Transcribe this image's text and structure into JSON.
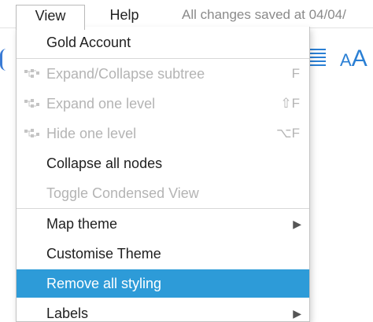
{
  "menubar": {
    "view_label": "View",
    "help_label": "Help",
    "save_status": "All changes saved at 04/04/"
  },
  "toolbar": {
    "font_icon_text_small": "A",
    "font_icon_text_large": "A"
  },
  "dropdown": {
    "account": "Gold Account",
    "expand_collapse_subtree": {
      "label": "Expand/Collapse subtree",
      "shortcut": "F",
      "icon": "tree-icon"
    },
    "expand_one_level": {
      "label": "Expand one level",
      "shortcut": "⇧F",
      "icon": "tree-icon"
    },
    "hide_one_level": {
      "label": "Hide one level",
      "shortcut": "⌥F",
      "icon": "tree-icon"
    },
    "collapse_all_nodes": "Collapse all nodes",
    "toggle_condensed_view": "Toggle Condensed View",
    "map_theme": "Map theme",
    "customise_theme": "Customise Theme",
    "remove_all_styling": "Remove all styling",
    "labels": "Labels",
    "submenu_arrow": "▶"
  },
  "colors": {
    "highlight": "#2d9bd8",
    "disabled_text": "#b4b4b4",
    "accent_blue": "#2a7fd4"
  }
}
